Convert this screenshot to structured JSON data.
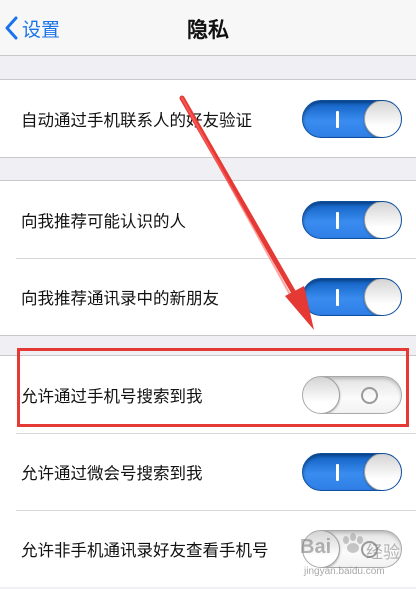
{
  "navbar": {
    "back_label": "设置",
    "title": "隐私"
  },
  "groups": [
    {
      "rows": [
        {
          "label": "自动通过手机联系人的好友验证",
          "on": true
        }
      ]
    },
    {
      "rows": [
        {
          "label": "向我推荐可能认识的人",
          "on": true
        },
        {
          "label": "向我推荐通讯录中的新朋友",
          "on": true
        }
      ]
    },
    {
      "rows": [
        {
          "label": "允许通过手机号搜索到我",
          "on": false
        },
        {
          "label": "允许通过微会号搜索到我",
          "on": true
        },
        {
          "label": "允许非手机通讯录好友查看手机号",
          "on": false
        }
      ]
    }
  ],
  "watermark": {
    "brand": "Bai",
    "brand_suffix": "经验",
    "url": "jingyan.baidu.com"
  },
  "colors": {
    "accent": "#1a73e8",
    "switch_on": "#2f7fe6",
    "annotation": "#e53935"
  }
}
